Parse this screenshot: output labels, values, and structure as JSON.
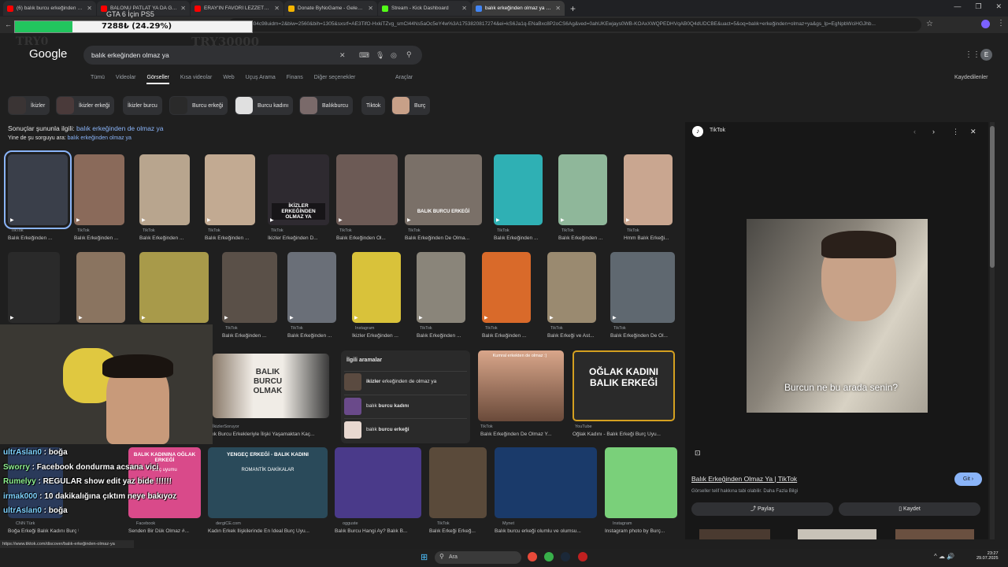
{
  "browser": {
    "tabs": [
      {
        "title": "(6) balık burcu erkeğinden de o",
        "color": "#ff0000"
      },
      {
        "title": "BALONU PATLAT YA DA GERÇEĞ",
        "color": "#ff0000"
      },
      {
        "title": "ERAY'IN FAVORİ LEZZETLERİNİ",
        "color": "#ff0000"
      },
      {
        "title": "Donate ByNoGame - Gelen/Gid",
        "color": "#f4b400"
      },
      {
        "title": "Stream - Kick Dashboard",
        "color": "#53fc18"
      },
      {
        "title": "balık erkeğinden olmaz ya - C",
        "color": "#4285f4"
      }
    ],
    "new_tab": "+",
    "url": "304c98uidm=2&biw=2560&bih=1305&sxsrf=AE3TifO-HxkiTZvg_smCl44Ns5aOc5eY4w%3A1753820817274&ei=kS6Ja1q-ENaBxc8P2oCS6Ag&ved=0ahUKEwjays0WB-KOAxXWQPEDHVqAB0Q4dUDCBE&uact=5&oq=balık+erkeğinden+olmaz+ya&gs_lp=EgNpbWciHGJhb...",
    "status_url": "https://www.tiktok.com/discover/balık-erkeğinden-olmaz-ya"
  },
  "overlay": {
    "goal_label": "GTA 6 İçin PS5",
    "progress_text": "7288₺ (24.29%)",
    "progress_percent": 24.29,
    "left_label": "TRY0",
    "right_label": "TRY30000"
  },
  "google": {
    "logo": "Google",
    "query": "balık erkeğinden olmaz ya",
    "nav": [
      "Tümü",
      "Videolar",
      "Görseller",
      "Kısa videolar",
      "Web",
      "Uçuş Arama",
      "Finans",
      "Diğer seçenekler"
    ],
    "tools": "Araçlar",
    "saved": "Kaydedilenler",
    "chips": [
      "İkizler",
      "İkizler erkeği",
      "İkizler burcu",
      "Burcu erkeği",
      "Burcu kadını",
      "Balıkburcu",
      "Tiktok",
      "Burç"
    ],
    "related_prefix": "Sonuçlar şununla ilgili: ",
    "related_query": "balık erkeğinden de olmaz ya",
    "also_prefix": "Yine de şu sorguyu ara: ",
    "also_query": "balık erkeğinden olmaz ya"
  },
  "row1": [
    {
      "src": "TikTok",
      "cap": "Balık Erkeğinden ...",
      "color": "#3a3f4a"
    },
    {
      "src": "TikTok",
      "cap": "Balık Erkeğinden ...",
      "color": "#8a6a5a"
    },
    {
      "src": "TikTok",
      "cap": "Balık Erkeğinden ...",
      "color": "#b8a58e"
    },
    {
      "src": "TikTok",
      "cap": "Balık Erkeğinden ...",
      "color": "#c2aa92"
    },
    {
      "src": "TikTok",
      "cap": "İkizler Erkeğinden D...",
      "color": "#2e2a30"
    },
    {
      "src": "TikTok",
      "cap": "Balık Erkeğinden Ol...",
      "color": "#6c5a55"
    },
    {
      "src": "TikTok",
      "cap": "Balık Erkeğinden De Olma...",
      "color": "#7a7068"
    },
    {
      "src": "TikTok",
      "cap": "Balık Erkeğinden ...",
      "color": "#2fb0b4"
    },
    {
      "src": "TikTok",
      "cap": "Balık Erkeğinden ...",
      "color": "#8fb79a"
    },
    {
      "src": "TikTok",
      "cap": "Hmm Balık Erkeği...",
      "color": "#c9a690"
    }
  ],
  "row1_overlays": [
    "İKİZLER ERKEĞİNDEN OLMAZ YA",
    "BALIK BURCU ERKEĞİ"
  ],
  "row2": [
    {
      "src": "",
      "cap": "",
      "color": "#2a2a2a"
    },
    {
      "src": "",
      "cap": "",
      "color": "#8a7460"
    },
    {
      "src": "",
      "cap": "",
      "color": "#a89a4a"
    },
    {
      "src": "TikTok",
      "cap": "Balık Erkeğinden ...",
      "color": "#5a5048"
    },
    {
      "src": "TikTok",
      "cap": "Balık Erkeğinden ...",
      "color": "#6a6f78"
    },
    {
      "src": "Instagram",
      "cap": "İkizler Erkeğinden ...",
      "color": "#d9c23a"
    },
    {
      "src": "TikTok",
      "cap": "Balık Erkeğinden ...",
      "color": "#8a857a"
    },
    {
      "src": "TikTok",
      "cap": "Balık Erkeğinden ...",
      "color": "#d96a2a"
    },
    {
      "src": "TikTok",
      "cap": "Balık Erkeği ve Ast...",
      "color": "#9a8a70"
    },
    {
      "src": "TikTok",
      "cap": "Balık Erkeğinden De Ol...",
      "color": "#5f6870"
    }
  ],
  "row3": {
    "balik_card": {
      "title": "BALIK BURCU OLMAK",
      "src": "İkizlerSoruyor",
      "cap": "ık Burcu Erkekleriyle İlişki Yaşamaktan Kaç..."
    },
    "related_box": {
      "title": "İlgili aramalar",
      "items": [
        {
          "bold": "ikizler",
          "rest": " erkeğinden de olmaz ya"
        },
        {
          "bold": "",
          "rest": "balık ",
          "bold2": "burcu kadını"
        },
        {
          "bold": "",
          "rest": "balık ",
          "bold2": "burcu erkeği"
        }
      ]
    },
    "kumral": {
      "text": "Kumral erkekten de olmaz :)",
      "src": "TikTok",
      "cap": "Balık Erkeğinden De Olmaz Y..."
    },
    "oglak": {
      "title": "OĞLAK KADINI BALIK ERKEĞİ",
      "src": "YouTube",
      "cap": "Oğlak Kadını - Balık Erkeği Burç Uyu..."
    }
  },
  "row4": [
    {
      "src": "CNN Türk",
      "cap": "Boğa Erkeği Balık Kadını Burç Uyumu ...",
      "color": "#2a3a5a"
    },
    {
      "src": "Facebook",
      "cap": "Senden Bir Dük Olmaz #...",
      "color": "#d94a8a",
      "title": "BALIK KADININA OĞLAK ERKEĞİ",
      "sub": "burç uyumu"
    },
    {
      "src": "dergiCE.com",
      "cap": "Kadın Erkek İlişkilerinde En İdeal Burç Uyu...",
      "color": "#2a4a5a",
      "title": "YENGEÇ ERKEĞİ - BALIK KADINI",
      "sub": "ROMANTİK DAKİKALAR"
    },
    {
      "src": "ogguste",
      "cap": "Balık Burcu Hangi Ay? Balık B...",
      "color": "#4a3a8a"
    },
    {
      "src": "TikTok",
      "cap": "Balık Erkeği Erkeğ...",
      "color": "#5a4a3a"
    },
    {
      "src": "Mynet",
      "cap": "Balık burcu erkeği olumlu ve olumsu...",
      "color": "#1a3a6a"
    },
    {
      "src": "Instagram",
      "cap": "Instagram photo by Burç...",
      "color": "#7ad07a"
    }
  ],
  "panel": {
    "source": "TikTok",
    "caption": "Burcun ne bu arada senin?",
    "title": "Balık Erkeğinden Olmaz Ya | TikTok",
    "note": "Görseller telif hakkına tabi olabilir. Daha Fazla Bilgi",
    "visit": "Git",
    "share": "Paylaş",
    "save": "Kaydet"
  },
  "chat": [
    {
      "user": "ultrAslan0",
      "msg": " : boğa",
      "g": false
    },
    {
      "user": "Sworry",
      "msg": " : Facebook dondurma acsana vici",
      "g": true
    },
    {
      "user": "Rumelyy",
      "msg": " : REGULAR show edit yaz bide !!!!!!",
      "g": true
    },
    {
      "user": "irmak000",
      "msg": " : 10 dakikalığına çıktım neye bakıyoz",
      "g": false
    },
    {
      "user": "ultrAslan0",
      "msg": " : boğa",
      "g": false
    }
  ],
  "taskbar": {
    "search": "Ara",
    "time": "23:27",
    "date": "29.07.2025"
  }
}
